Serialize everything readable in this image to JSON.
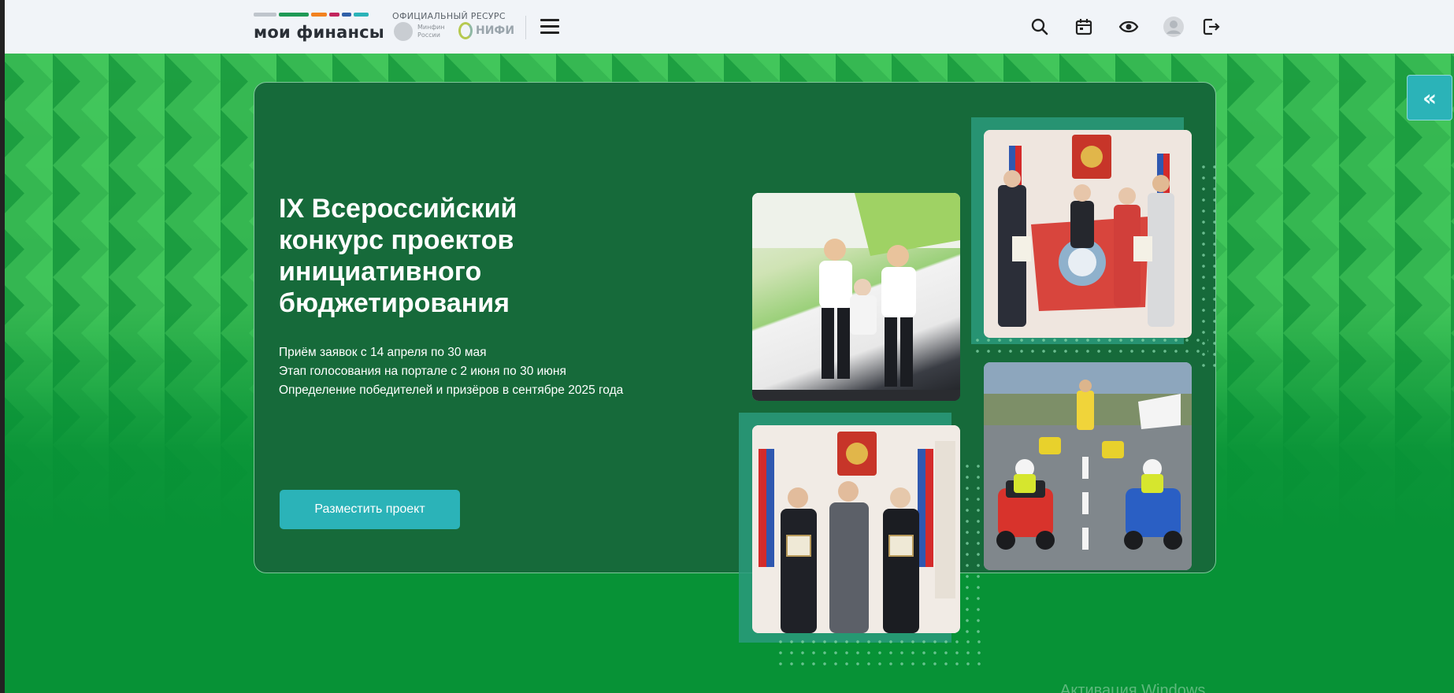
{
  "header": {
    "logo_text": "мои финансы",
    "logo_colors": [
      "#bfc5cc",
      "#1f9a55",
      "#f2821f",
      "#c2245d",
      "#2f5fa8",
      "#2bb3b8"
    ],
    "official_label": "ОФИЦИАЛЬНЫЙ РЕСУРС",
    "partner1_text": "Минфин России",
    "partner2_text": "НИФИ",
    "icons": [
      "menu-icon",
      "search-icon",
      "calendar-icon",
      "eye-icon",
      "avatar",
      "logout-icon"
    ]
  },
  "hero": {
    "title": "IX Всероссийский конкурс проектов инициативного бюджетирования",
    "info": [
      "Приём заявок с 14 апреля по 30 мая",
      "Этап голосования на портале с 2 июня по 30 июня",
      "Определение победителей и призёров в сентябре 2025 года"
    ],
    "cta_label": "Разместить проект",
    "side_button_label": "«",
    "accent_color": "#2bb3b8",
    "card_color": "#166a3a"
  },
  "photos": [
    "photo-dance",
    "photo-flag",
    "photo-kids",
    "photo-award"
  ],
  "watermark": "Активация Windows"
}
